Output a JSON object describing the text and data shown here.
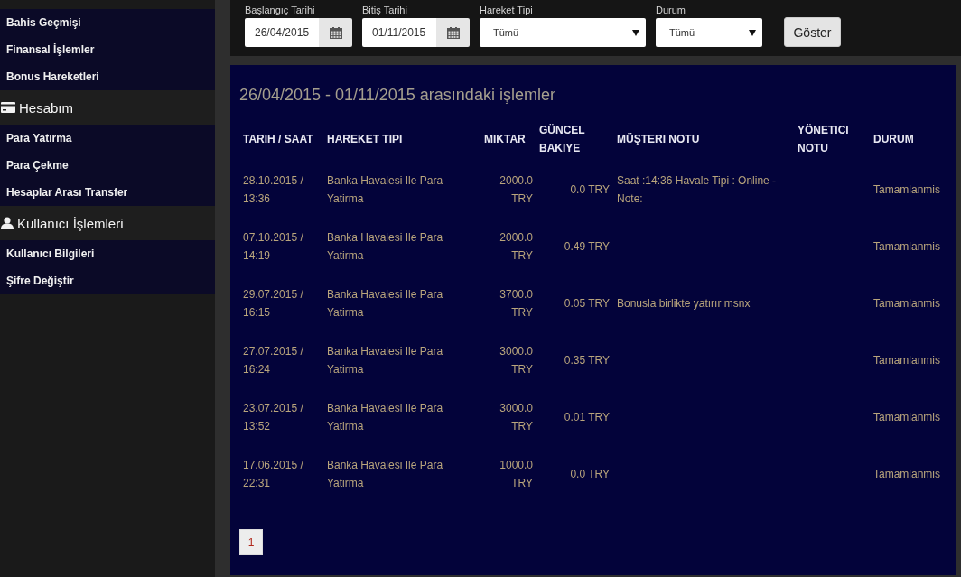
{
  "sidebar": {
    "groups": [
      {
        "items": [
          "Bahis Geçmişi",
          "Finansal İşlemler",
          "Bonus Hareketleri"
        ]
      },
      {
        "title": "Hesabım",
        "items": [
          "Para Yatırma",
          "Para Çekme",
          "Hesaplar Arası Transfer"
        ]
      },
      {
        "title": "Kullanıcı İşlemleri",
        "items": [
          "Kullanıcı Bilgileri",
          "Şifre Değiştir"
        ]
      }
    ]
  },
  "filters": {
    "fields": [
      {
        "kind": "date",
        "label": "Başlangıç Tarihi",
        "value": "26/04/2015"
      },
      {
        "kind": "date",
        "label": "Bitiş Tarihi",
        "value": "01/11/2015"
      },
      {
        "kind": "select",
        "label": "Hareket Tipi",
        "value": "Tümü"
      },
      {
        "kind": "select",
        "label": "Durum",
        "value": "Tümü"
      }
    ],
    "button": "Göster"
  },
  "transactions": {
    "title": "26/04/2015 - 01/11/2015 arasındaki işlemler",
    "table": {
      "columns": [
        "TARIH / SAAT",
        "HAREKET TIPI",
        "MIKTAR",
        "GÜNCEL BAKIYE",
        "MÜŞTERI NOTU",
        "YÖNETICI NOTU",
        "DURUM"
      ],
      "rows": [
        {
          "date_time": "28.10.2015 / 13:36",
          "type": "Banka Havalesi Ile Para Yatirma",
          "amount": "2000.0 TRY",
          "balance": "0.0 TRY",
          "customer_note": "Saat :14:36 Havale Tipi : Online - Note:",
          "status": "Tamamlanmis"
        },
        {
          "date_time": "07.10.2015 / 14:19",
          "type": "Banka Havalesi Ile Para Yatirma",
          "amount": "2000.0 TRY",
          "balance": "0.49 TRY",
          "status": "Tamamlanmis"
        },
        {
          "date_time": "29.07.2015 / 16:15",
          "type": "Banka Havalesi Ile Para Yatirma",
          "amount": "3700.0 TRY",
          "balance": "0.05 TRY",
          "customer_note": "Bonusla birlikte yatırır msnx",
          "status": "Tamamlanmis"
        },
        {
          "date_time": "27.07.2015 / 16:24",
          "type": "Banka Havalesi Ile Para Yatirma",
          "amount": "3000.0 TRY",
          "balance": "0.35 TRY",
          "status": "Tamamlanmis"
        },
        {
          "date_time": "23.07.2015 / 13:52",
          "type": "Banka Havalesi Ile Para Yatirma",
          "amount": "3000.0 TRY",
          "balance": "0.01 TRY",
          "status": "Tamamlanmis"
        },
        {
          "date_time": "17.06.2015 / 22:31",
          "type": "Banka Havalesi Ile Para Yatirma",
          "amount": "1000.0 TRY",
          "balance": "0.0 TRY",
          "status": "Tamamlanmis"
        }
      ]
    },
    "pagination": [
      {
        "label": "1",
        "selected": true
      }
    ]
  }
}
